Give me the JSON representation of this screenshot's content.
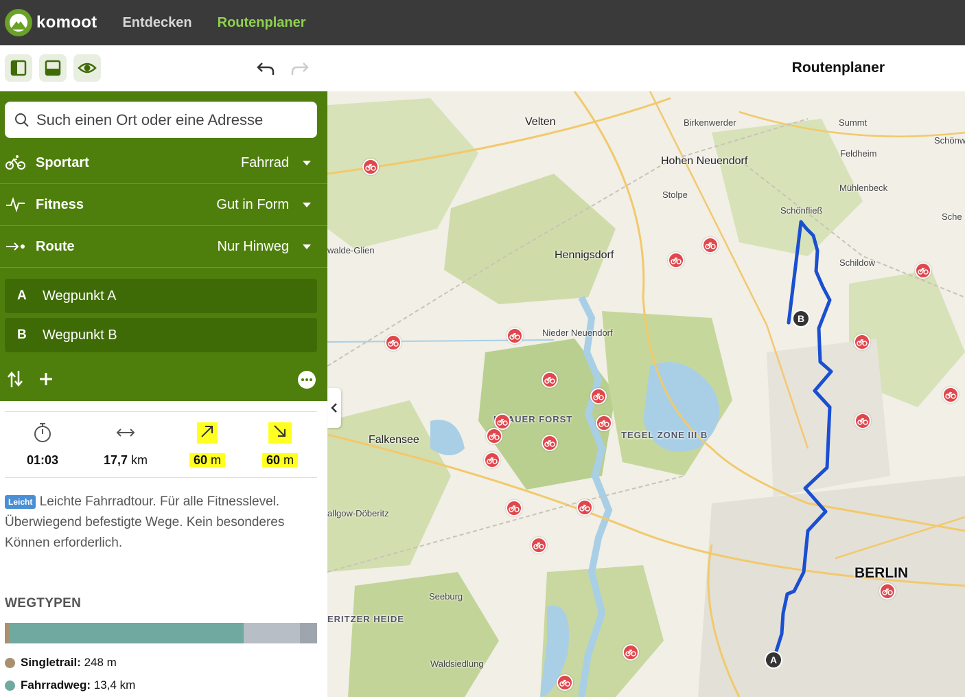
{
  "app": {
    "logo_text": "komoot",
    "nav": [
      {
        "label": "Entdecken",
        "active": false
      },
      {
        "label": "Routenplaner",
        "active": true
      }
    ],
    "accent": "#8fd14f",
    "brand_green": "#6aa127"
  },
  "toolbar": {
    "buttons": [
      "sidebar-layout-icon",
      "bottom-panel-icon",
      "eye-icon"
    ],
    "undo_icon": "undo-icon",
    "redo_icon": "redo-icon",
    "page_title": "Routenplaner"
  },
  "planner": {
    "search_placeholder": "Such einen Ort oder eine Adresse",
    "options": [
      {
        "icon": "bicycle-icon",
        "label": "Sportart",
        "value": "Fahrrad"
      },
      {
        "icon": "heartbeat-icon",
        "label": "Fitness",
        "value": "Gut in Form"
      },
      {
        "icon": "route-arrow-icon",
        "label": "Route",
        "value": "Nur Hinweg"
      }
    ],
    "waypoints": [
      {
        "letter": "A",
        "name": "Wegpunkt A"
      },
      {
        "letter": "B",
        "name": "Wegpunkt B"
      }
    ],
    "panel_color": "#4e7f0c"
  },
  "stats": {
    "duration": "01:03",
    "distance_value": "17,7",
    "distance_unit": "km",
    "uphill_value": "60",
    "uphill_unit": "m",
    "downhill_value": "60",
    "downhill_unit": "m"
  },
  "difficulty": {
    "badge": "Leicht",
    "text": "Leichte Fahrradtour. Für alle Fitnesslevel. Überwiegend befestigte Wege. Kein besonderes Können erforderlich."
  },
  "wegtypen": {
    "title": "WEGTYPEN",
    "segments": [
      {
        "color": "#a89070",
        "fraction": 0.014
      },
      {
        "color": "#6fa9a0",
        "fraction": 0.75
      },
      {
        "color": "#b8bec6",
        "fraction": 0.18
      },
      {
        "color": "#9ea5ae",
        "fraction": 0.056
      }
    ],
    "legend": [
      {
        "label": "Singletrail:",
        "value": "248 m",
        "color": "#a89070"
      },
      {
        "label": "Fahrradweg:",
        "value": "13,4 km",
        "color": "#6fa9a0"
      }
    ]
  },
  "map": {
    "places": [
      {
        "name": "Velten",
        "size": "m"
      },
      {
        "name": "Birkenwerder",
        "size": "s"
      },
      {
        "name": "Summt",
        "size": "s"
      },
      {
        "name": "Schönw",
        "size": "s"
      },
      {
        "name": "Feldheim",
        "size": "s"
      },
      {
        "name": "Hohen Neuendorf",
        "size": "m"
      },
      {
        "name": "Mühlenbeck",
        "size": "s"
      },
      {
        "name": "Stolpe",
        "size": "s"
      },
      {
        "name": "Schönfließ",
        "size": "s"
      },
      {
        "name": "Sche",
        "size": "s"
      },
      {
        "name": "walde-Glien",
        "size": "s"
      },
      {
        "name": "Hennigsdorf",
        "size": "m"
      },
      {
        "name": "Schildow",
        "size": "s"
      },
      {
        "name": "Nieder Neuendorf",
        "size": "s"
      },
      {
        "name": "NDAUER FORST",
        "size": "r"
      },
      {
        "name": "TEGEL ZONE III B",
        "size": "r"
      },
      {
        "name": "Falkensee",
        "size": "m"
      },
      {
        "name": "allgow-Döberitz",
        "size": "s"
      },
      {
        "name": "BERLIN",
        "size": "l"
      },
      {
        "name": "Seeburg",
        "size": "s"
      },
      {
        "name": "ERITZER HEIDE",
        "size": "r"
      },
      {
        "name": "Waldsiedlung",
        "size": "s"
      }
    ],
    "markers": [
      {
        "letter": "A"
      },
      {
        "letter": "B"
      }
    ],
    "route_color": "#1a4fd1",
    "poi_color": "#e0474c",
    "collapse_icon": "chevron-left-icon"
  }
}
